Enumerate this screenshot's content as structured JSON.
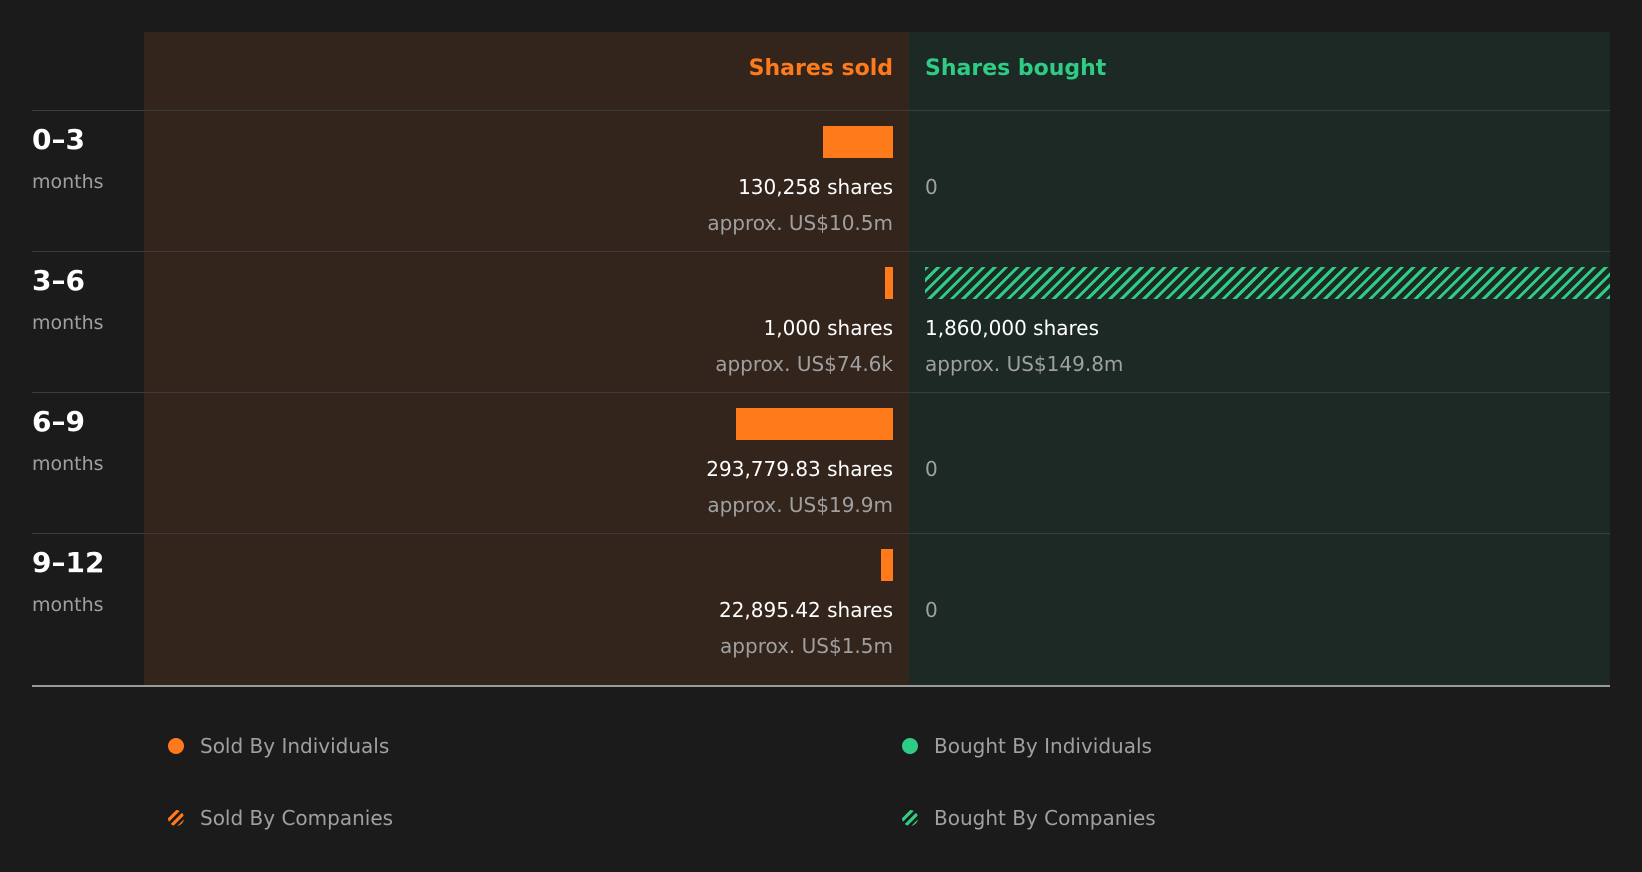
{
  "chart_data": {
    "type": "bar",
    "columns": {
      "sold_label": "Shares sold",
      "bought_label": "Shares bought"
    },
    "unit_label": "months",
    "categories": [
      "0–3",
      "3–6",
      "6–9",
      "9–12"
    ],
    "series": [
      {
        "name": "Shares sold",
        "values": [
          130258,
          1000,
          293779.83,
          22895.42
        ],
        "shares_text": [
          "130,258 shares",
          "1,000 shares",
          "293,779.83 shares",
          "22,895.42 shares"
        ],
        "usd_text": [
          "approx. US$10.5m",
          "approx. US$74.6k",
          "approx. US$19.9m",
          "approx. US$1.5m"
        ],
        "by_companies": [
          false,
          false,
          false,
          false
        ]
      },
      {
        "name": "Shares bought",
        "values": [
          0,
          1860000,
          0,
          0
        ],
        "shares_text": [
          "0",
          "1,860,000 shares",
          "0",
          "0"
        ],
        "usd_text": [
          "",
          "approx. US$149.8m",
          "",
          ""
        ],
        "by_companies": [
          false,
          true,
          false,
          false
        ]
      }
    ],
    "legend": [
      "Sold By Individuals",
      "Bought By Individuals",
      "Sold By Companies",
      "Bought By Companies"
    ],
    "colors": {
      "sold": "#ff7a1a",
      "bought": "#2fcc85"
    }
  }
}
